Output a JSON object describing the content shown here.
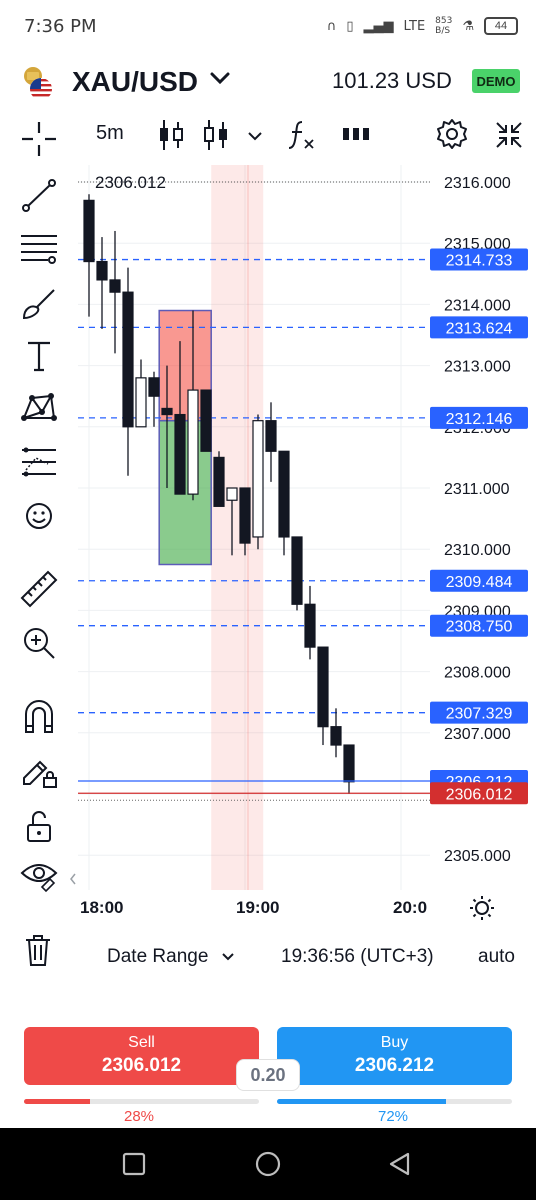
{
  "status_bar": {
    "time": "7:36 PM",
    "net_speed": "853",
    "net_unit": "B/S",
    "signal": "LTE",
    "battery": "44"
  },
  "header": {
    "symbol": "XAU/USD",
    "balance": "101.23 USD",
    "account_badge": "DEMO"
  },
  "toolbar": {
    "interval": "5m"
  },
  "chart_data": {
    "type": "candlestick",
    "price_axis_ticks": [
      "2316.000",
      "2315.000",
      "2314.000",
      "2313.000",
      "2312.000",
      "2311.000",
      "2310.000",
      "2309.000",
      "2308.000",
      "2307.000",
      "2305.000"
    ],
    "time_axis_ticks": [
      "18:00",
      "19:00",
      "20:0"
    ],
    "high_marker": "2306.012",
    "horizontal_lines": [
      {
        "price": "2314.733",
        "color": "#2962ff",
        "style": "dashed"
      },
      {
        "price": "2313.624",
        "color": "#2962ff",
        "style": "dashed"
      },
      {
        "price": "2312.146",
        "color": "#2962ff",
        "style": "dashed"
      },
      {
        "price": "2309.484",
        "color": "#2962ff",
        "style": "dashed"
      },
      {
        "price": "2308.750",
        "color": "#2962ff",
        "style": "dashed"
      },
      {
        "price": "2307.329",
        "color": "#2962ff",
        "style": "dashed"
      }
    ],
    "ask_line": {
      "price": "2306.212",
      "color": "#2962ff"
    },
    "bid_line": {
      "price": "2306.012",
      "color": "#d32f2f"
    },
    "position_tool": {
      "entry": 2312.1,
      "stop": 2313.9,
      "target": 2309.75,
      "start_time": "18:27",
      "end_time": "18:47"
    },
    "highlight_range": {
      "start_time": "18:47",
      "end_time": "19:07"
    },
    "candles": [
      {
        "t": "18:00",
        "o": 2315.7,
        "h": 2315.8,
        "l": 2313.8,
        "c": 2314.7
      },
      {
        "t": "18:05",
        "o": 2314.7,
        "h": 2315.1,
        "l": 2313.6,
        "c": 2314.4
      },
      {
        "t": "18:10",
        "o": 2314.4,
        "h": 2315.2,
        "l": 2313.2,
        "c": 2314.2
      },
      {
        "t": "18:15",
        "o": 2314.2,
        "h": 2314.6,
        "l": 2311.2,
        "c": 2312.0
      },
      {
        "t": "18:20",
        "o": 2312.0,
        "h": 2313.1,
        "l": 2312.0,
        "c": 2312.8
      },
      {
        "t": "18:25",
        "o": 2312.8,
        "h": 2312.9,
        "l": 2312.0,
        "c": 2312.5
      },
      {
        "t": "18:30",
        "o": 2312.3,
        "h": 2313.0,
        "l": 2311.0,
        "c": 2312.2
      },
      {
        "t": "18:35",
        "o": 2312.2,
        "h": 2313.4,
        "l": 2310.9,
        "c": 2310.9
      },
      {
        "t": "18:40",
        "o": 2310.9,
        "h": 2313.9,
        "l": 2310.8,
        "c": 2312.6
      },
      {
        "t": "18:45",
        "o": 2312.6,
        "h": 2312.6,
        "l": 2311.6,
        "c": 2311.6
      },
      {
        "t": "18:50",
        "o": 2311.5,
        "h": 2311.6,
        "l": 2310.7,
        "c": 2310.7
      },
      {
        "t": "18:55",
        "o": 2310.8,
        "h": 2311.0,
        "l": 2309.9,
        "c": 2311.0
      },
      {
        "t": "19:00",
        "o": 2311.0,
        "h": 2311.0,
        "l": 2309.9,
        "c": 2310.1
      },
      {
        "t": "19:05",
        "o": 2310.2,
        "h": 2312.2,
        "l": 2310.0,
        "c": 2312.1
      },
      {
        "t": "19:10",
        "o": 2312.1,
        "h": 2312.4,
        "l": 2311.1,
        "c": 2311.6
      },
      {
        "t": "19:15",
        "o": 2311.6,
        "h": 2311.6,
        "l": 2309.9,
        "c": 2310.2
      },
      {
        "t": "19:20",
        "o": 2310.2,
        "h": 2310.2,
        "l": 2309.0,
        "c": 2309.1
      },
      {
        "t": "19:25",
        "o": 2309.1,
        "h": 2309.4,
        "l": 2308.2,
        "c": 2308.4
      },
      {
        "t": "19:30",
        "o": 2308.4,
        "h": 2308.4,
        "l": 2306.8,
        "c": 2307.1
      },
      {
        "t": "19:35",
        "o": 2307.1,
        "h": 2307.4,
        "l": 2306.6,
        "c": 2306.8
      },
      {
        "t": "19:40",
        "o": 2306.8,
        "h": 2306.8,
        "l": 2306.0,
        "c": 2306.2
      }
    ]
  },
  "bottom": {
    "date_range": "Date Range",
    "clock": "19:36:56 (UTC+3)",
    "scale_mode": "auto"
  },
  "trade": {
    "sell_label": "Sell",
    "sell_price": "2306.012",
    "buy_label": "Buy",
    "buy_price": "2306.212",
    "spread": "0.20",
    "sell_pct_text": "28%",
    "sell_pct": 0.28,
    "buy_pct_text": "72%",
    "buy_pct": 0.72,
    "sell_color": "#ef4a48",
    "buy_color": "#2196f3"
  }
}
